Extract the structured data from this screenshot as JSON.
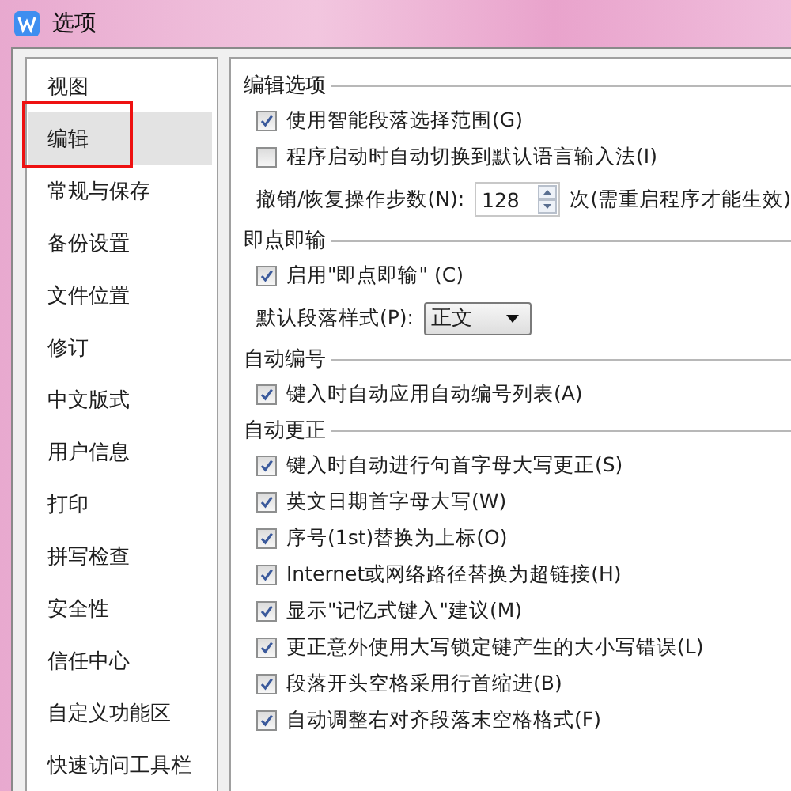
{
  "window": {
    "title": "选项"
  },
  "sidebar": {
    "items": [
      {
        "label": "视图",
        "selected": false,
        "annotated": false
      },
      {
        "label": "编辑",
        "selected": true,
        "annotated": true
      },
      {
        "label": "常规与保存",
        "selected": false,
        "annotated": false
      },
      {
        "label": "备份设置",
        "selected": false,
        "annotated": false
      },
      {
        "label": "文件位置",
        "selected": false,
        "annotated": false
      },
      {
        "label": "修订",
        "selected": false,
        "annotated": false
      },
      {
        "label": "中文版式",
        "selected": false,
        "annotated": false
      },
      {
        "label": "用户信息",
        "selected": false,
        "annotated": false
      },
      {
        "label": "打印",
        "selected": false,
        "annotated": false
      },
      {
        "label": "拼写检查",
        "selected": false,
        "annotated": false
      },
      {
        "label": "安全性",
        "selected": false,
        "annotated": false
      },
      {
        "label": "信任中心",
        "selected": false,
        "annotated": false
      },
      {
        "label": "自定义功能区",
        "selected": false,
        "annotated": false
      },
      {
        "label": "快速访问工具栏",
        "selected": false,
        "annotated": false
      }
    ]
  },
  "sections": [
    {
      "title": "编辑选项",
      "rows": [
        {
          "kind": "checkbox",
          "label": "使用智能段落选择范围(G)",
          "checked": true
        },
        {
          "kind": "checkbox",
          "label": "程序启动时自动切换到默认语言输入法(I)",
          "checked": false
        },
        {
          "kind": "spinner",
          "label": "撤销/恢复操作步数(N):",
          "value": "128",
          "note": "次(需重启程序才能生效)"
        }
      ]
    },
    {
      "title": "即点即输",
      "rows": [
        {
          "kind": "checkbox",
          "label": "启用\"即点即输\" (C)",
          "checked": true
        },
        {
          "kind": "dropdown",
          "label": "默认段落样式(P):",
          "value": "正文"
        }
      ]
    },
    {
      "title": "自动编号",
      "rows": [
        {
          "kind": "checkbox",
          "label": "键入时自动应用自动编号列表(A)",
          "checked": true
        }
      ]
    },
    {
      "title": "自动更正",
      "rows": [
        {
          "kind": "checkbox",
          "label": "键入时自动进行句首字母大写更正(S)",
          "checked": true
        },
        {
          "kind": "checkbox",
          "label": "英文日期首字母大写(W)",
          "checked": true
        },
        {
          "kind": "checkbox",
          "label": "序号(1st)替换为上标(O)",
          "checked": true
        },
        {
          "kind": "checkbox",
          "label": "Internet或网络路径替换为超链接(H)",
          "checked": true
        },
        {
          "kind": "checkbox",
          "label": "显示\"记忆式键入\"建议(M)",
          "checked": true
        },
        {
          "kind": "checkbox",
          "label": "更正意外使用大写锁定键产生的大小写错误(L)",
          "checked": true
        },
        {
          "kind": "checkbox",
          "label": "段落开头空格采用行首缩进(B)",
          "checked": true
        },
        {
          "kind": "checkbox",
          "label": "自动调整右对齐段落末空格格式(F)",
          "checked": true
        }
      ]
    }
  ]
}
